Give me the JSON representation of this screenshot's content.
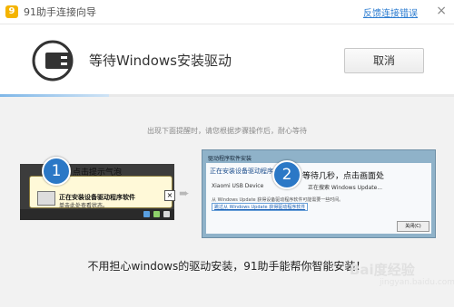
{
  "titlebar": {
    "app_title": "91助手连接向导",
    "feedback_link": "反馈连接错误",
    "close_glyph": "×",
    "logo_glyph": "9"
  },
  "header": {
    "title": "等待Windows安装驱动",
    "cancel_label": "取消",
    "progress_fraction": 0.24
  },
  "content": {
    "hint": "出现下面提醒时，请您根据步骤操作后，耐心等待",
    "step1": {
      "number": "1",
      "label": "点击提示气泡",
      "balloon_title": "正在安装设备驱动程序软件",
      "balloon_subtitle": "单击此处查看状态。",
      "close_glyph": "×"
    },
    "arrow_glyph": "➨",
    "step2": {
      "number": "2",
      "label": "等待几秒，点击画面处",
      "dialog_title": "驱动程序软件安装",
      "dialog_heading": "正在安装设备驱动程序软件",
      "device_name": "Xiaomi USB Device",
      "device_status": "正在搜索 Windows Update...",
      "description": "从 Windows Update 获得设备驱动程序软件可能需要一些时间。",
      "skip_link": "跳过从 Windows Update 获得驱动程序软件",
      "close_button": "关闭(C)"
    },
    "footer": "不用担心windows的驱动安装，91助手能帮你智能安装！"
  },
  "watermark": {
    "text": "Bai度经验",
    "subtext": "jingyan.baidu.com"
  }
}
